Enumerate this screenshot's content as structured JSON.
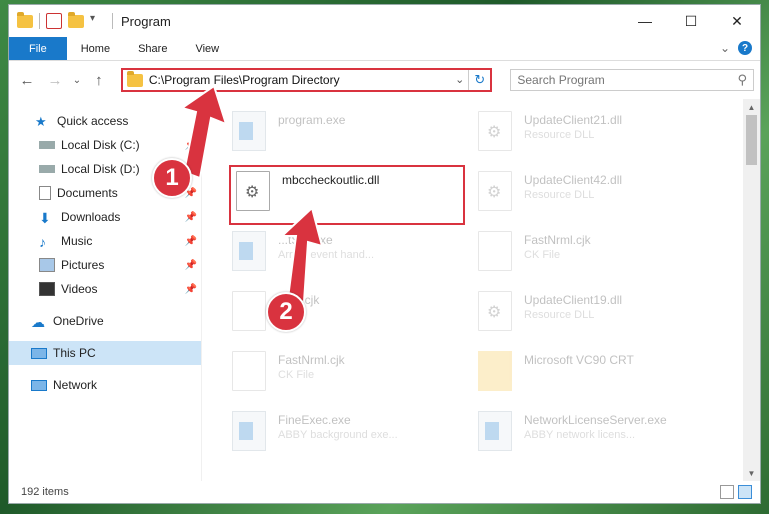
{
  "window": {
    "title": "Program",
    "controls": {
      "minimize": "—",
      "maximize": "☐",
      "close": "✕"
    }
  },
  "ribbon": {
    "tabs": [
      "File",
      "Home",
      "Share",
      "View"
    ],
    "help": "?",
    "expand": "⌄"
  },
  "address": {
    "path": "C:\\Program Files\\Program Directory",
    "back": "←",
    "forward": "→",
    "recent": "⌄",
    "up": "↑",
    "dropdown": "⌄",
    "refresh": "↻"
  },
  "search": {
    "placeholder": "Search Program",
    "icon": "magnifier-icon"
  },
  "sidebar": {
    "items": [
      {
        "label": "Quick access",
        "icon": "star-icon",
        "pinned": false
      },
      {
        "label": "Local Disk (C:)",
        "icon": "drive-icon",
        "pinned": true
      },
      {
        "label": "Local Disk (D:)",
        "icon": "drive-icon",
        "pinned": true
      },
      {
        "label": "Documents",
        "icon": "documents-icon",
        "pinned": true
      },
      {
        "label": "Downloads",
        "icon": "download-icon",
        "pinned": true
      },
      {
        "label": "Music",
        "icon": "music-icon",
        "pinned": true
      },
      {
        "label": "Pictures",
        "icon": "pictures-icon",
        "pinned": true
      },
      {
        "label": "Videos",
        "icon": "videos-icon",
        "pinned": true
      },
      {
        "label": "OneDrive",
        "icon": "cloud-icon",
        "pinned": false
      },
      {
        "label": "This PC",
        "icon": "computer-icon",
        "pinned": false,
        "selected": true
      },
      {
        "label": "Network",
        "icon": "network-icon",
        "pinned": false
      }
    ]
  },
  "files": [
    {
      "name": "program.exe",
      "sub": "",
      "type": "exe",
      "faded": true
    },
    {
      "name": "UpdateClient21.dll",
      "sub": "Resource DLL",
      "type": "dll",
      "faded": true
    },
    {
      "name": "mbccheckoutlic.dll",
      "sub": "",
      "type": "dll",
      "faded": false
    },
    {
      "name": "UpdateClient42.dll",
      "sub": "Resource DLL",
      "type": "dll",
      "faded": true
    },
    {
      "name": "...tSTI.exe",
      "sub": "Arr sh event hand...",
      "type": "exe",
      "faded": true
    },
    {
      "name": "FastNrml.cjk",
      "sub": "CK File",
      "type": "doc",
      "faded": true
    },
    {
      "name": "...an.cjk",
      "sub": "",
      "type": "doc",
      "faded": true
    },
    {
      "name": "UpdateClient19.dll",
      "sub": "Resource DLL",
      "type": "dll",
      "faded": true
    },
    {
      "name": "FastNrml.cjk",
      "sub": "CK File",
      "type": "doc",
      "faded": true
    },
    {
      "name": "Microsoft VC90 CRT",
      "sub": "",
      "type": "folder",
      "faded": true
    },
    {
      "name": "FineExec.exe",
      "sub": "ABBY background exe...",
      "type": "exe",
      "faded": true
    },
    {
      "name": "NetworkLicenseServer.exe",
      "sub": "ABBY network licens...",
      "type": "exe",
      "faded": true
    }
  ],
  "status": {
    "count": "192 items"
  },
  "annotations": [
    "1",
    "2"
  ],
  "colors": {
    "accent": "#1979ca",
    "highlight": "#d9333f"
  }
}
